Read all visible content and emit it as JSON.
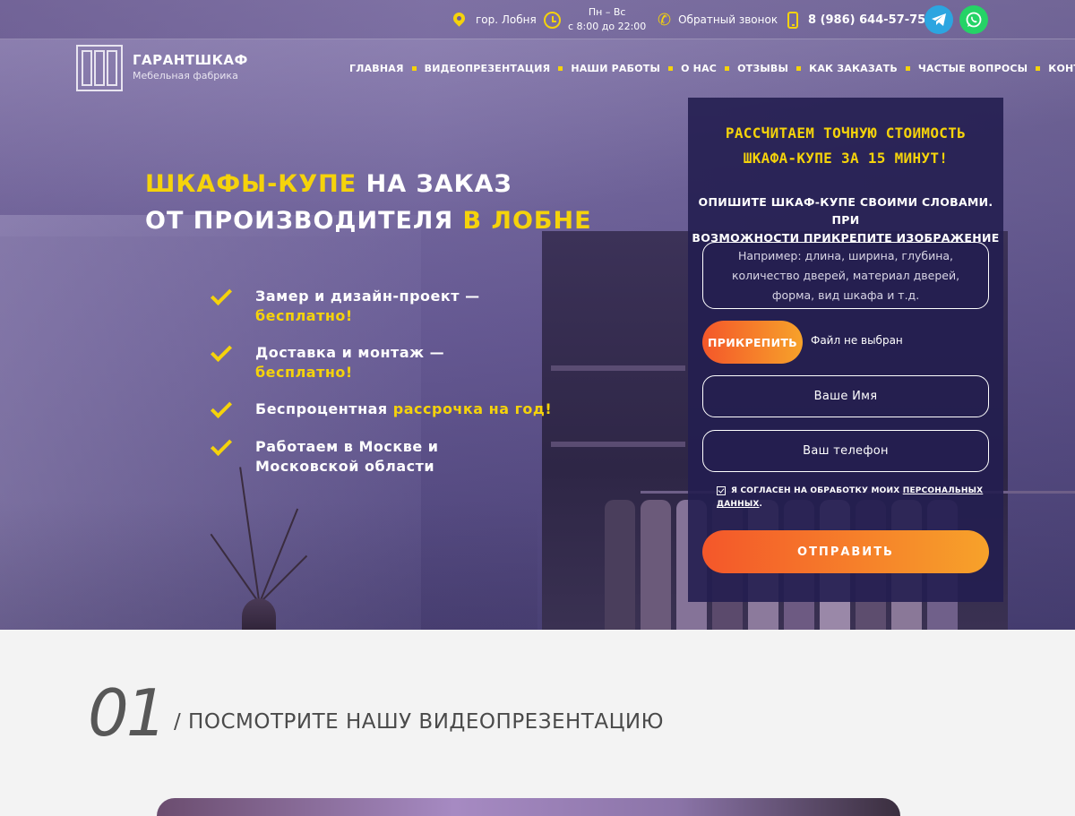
{
  "topbar": {
    "city": "гор. Лобня",
    "hours_days": "Пн – Вс",
    "hours_time": "с 8:00 до 22:00",
    "callback": "Обратный звонок",
    "phone": "8 (986) 644-57-75",
    "icons": [
      "location-pin-icon",
      "clock-icon",
      "phone-icon",
      "mobile-icon",
      "telegram-icon",
      "whatsapp-icon"
    ],
    "telegram_color": "#2ca5e0",
    "whatsapp_color": "#25d366"
  },
  "header": {
    "brand": "ГАРАНТШКАФ",
    "tagline": "Мебельная фабрика",
    "nav": [
      "ГЛАВНАЯ",
      "ВИДЕОПРЕЗЕНТАЦИЯ",
      "НАШИ РАБОТЫ",
      "О НАС",
      "ОТЗЫВЫ",
      "КАК ЗАКАЗАТЬ",
      "ЧАСТЫЕ ВОПРОСЫ",
      "КОНТАКТЫ"
    ]
  },
  "hero": {
    "title_line1_accent": "ШКАФЫ-КУПЕ",
    "title_line1_rest": " НА ЗАКАЗ",
    "title_line2_rest": "ОТ ПРОИЗВОДИТЕЛЯ ",
    "title_line2_accent": "В ЛОБНЕ",
    "benefits": [
      {
        "text": "Замер и дизайн-проект — ",
        "accent": "бесплатно!"
      },
      {
        "text": "Доставка и монтаж — ",
        "accent": "бесплатно!"
      },
      {
        "text": "Беспроцентная ",
        "accent": "рассрочка на год!"
      },
      {
        "text": "Работаем в Москве и Московской области",
        "accent": ""
      }
    ]
  },
  "form": {
    "title_line1": "РАССЧИТАЕМ ТОЧНУЮ СТОИМОСТЬ",
    "title_line2": "ШКАФА-КУПЕ ЗА 15 МИНУТ!",
    "subtitle_line1": "ОПИШИТЕ ШКАФ-КУПЕ СВОИМИ СЛОВАМИ. ПРИ",
    "subtitle_line2": "ВОЗМОЖНОСТИ ПРИКРЕПИТЕ ИЗОБРАЖЕНИЕ",
    "description_placeholder": "Например: длина, ширина, глубина, количество дверей, материал дверей, форма, вид шкафа и т.д.",
    "attach_label": "ПРИКРЕПИТЬ",
    "file_status": "Файл не выбран",
    "name_placeholder": "Ваше Имя",
    "phone_placeholder": "Ваш телефон",
    "consent_text": "Я СОГЛАСЕН НА ОБРАБОТКУ МОИХ ",
    "consent_link": "ПЕРСОНАЛЬНЫХ ДАННЫХ",
    "consent_end": ".",
    "consent_checked": true,
    "submit_label": "ОТПРАВИТЬ",
    "accent_gradient": [
      "#f4572a",
      "#f7a22a"
    ]
  },
  "section": {
    "number": "01",
    "title": "/ ПОСМОТРИТЕ НАШУ ВИДЕОПРЕЗЕНТАЦИЮ"
  },
  "colors": {
    "accent_yellow": "#f5d30b",
    "form_bg": "#231e50"
  }
}
